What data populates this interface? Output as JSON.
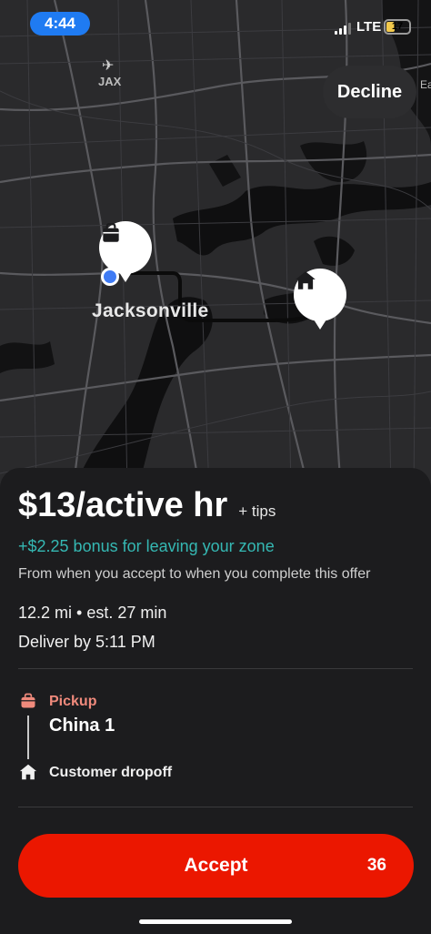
{
  "status_bar": {
    "time": "4:44",
    "network": "LTE",
    "battery": "17"
  },
  "map": {
    "airport_label": "JAX",
    "city_label": "Jacksonville",
    "edge_label": "Ea",
    "decline_label": "Decline",
    "icons": [
      "airplane-icon",
      "bag-icon",
      "house-icon",
      "driver-location-dot"
    ]
  },
  "offer": {
    "rate": "$13/active hr",
    "tips": "+ tips",
    "bonus": "+$2.25 bonus for leaving your zone",
    "note": "From when you accept to when you complete this offer",
    "distance": "12.2 mi • est. 27 min",
    "deliver_by": "Deliver by 5:11 PM"
  },
  "route": {
    "pickup_label": "Pickup",
    "store_name": "China 1",
    "dropoff_label": "Customer dropoff"
  },
  "accept": {
    "label": "Accept",
    "countdown": "36"
  },
  "colors": {
    "accent": "#eb1700",
    "bonus": "#35b8b3",
    "pickup": "#f08a7c",
    "location_dot": "#3f7bf4",
    "time_pill": "#1f7bf2"
  }
}
